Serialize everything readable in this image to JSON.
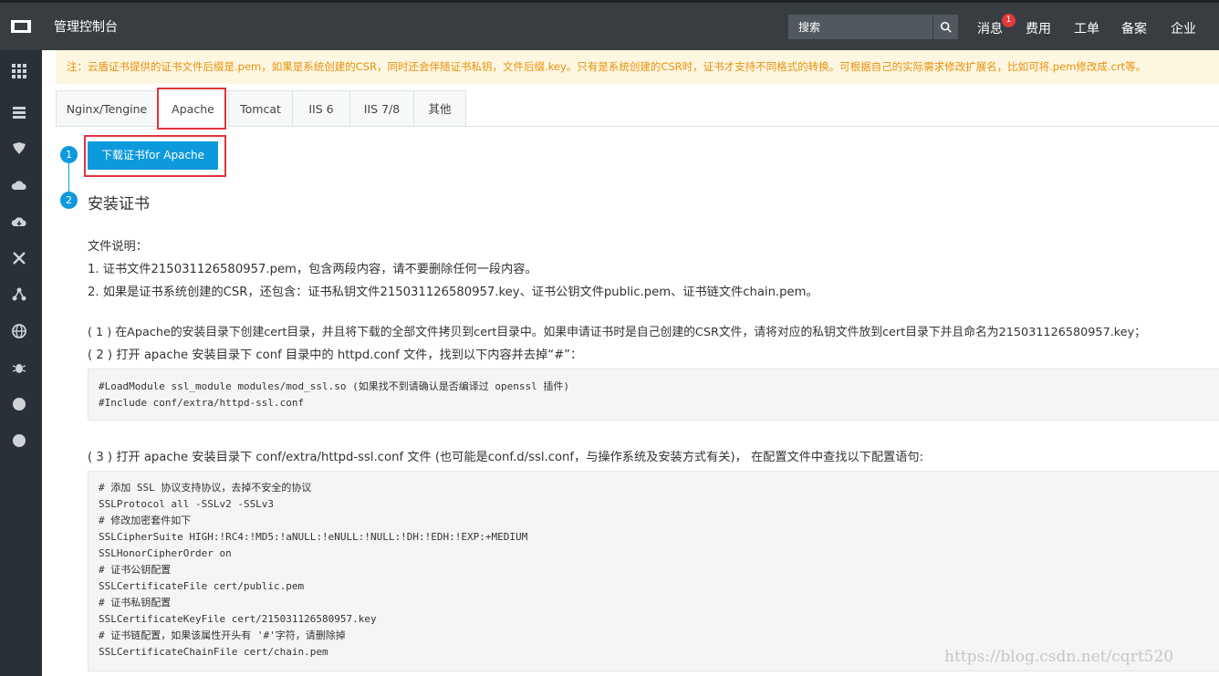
{
  "header": {
    "title": "管理控制台",
    "search_placeholder": "搜索",
    "nav": [
      "消息",
      "费用",
      "工单",
      "备案",
      "企业"
    ],
    "message_badge": "1"
  },
  "sidebar": {
    "icons": [
      "grid-icon",
      "list-icon",
      "shield-icon",
      "cloud-icon",
      "cloud-download-icon",
      "cross-icon",
      "nodes-icon",
      "globe-icon",
      "bug-icon",
      "circle-icon",
      "circle-icon"
    ]
  },
  "notice": "注：云盾证书提供的证书文件后缀是.pem，如果是系统创建的CSR，同时还会伴随证书私钥，文件后缀.key。只有是系统创建的CSR时，证书才支持不同格式的转换。可根据自己的实际需求修改扩展名，比如可将.pem修改成.crt等。",
  "tabs": [
    {
      "label": "Nginx/Tengine",
      "active": false
    },
    {
      "label": "Apache",
      "active": true
    },
    {
      "label": "Tomcat",
      "active": false
    },
    {
      "label": "IIS 6",
      "active": false
    },
    {
      "label": "IIS 7/8",
      "active": false
    },
    {
      "label": "其他",
      "active": false
    }
  ],
  "steps": {
    "step1_number": "1",
    "download_button": "下载证书for Apache",
    "step2_number": "2",
    "step2_title": "安装证书"
  },
  "content": {
    "file_desc_title": "文件说明：",
    "file_desc_1": "1. 证书文件215031126580957.pem，包含两段内容，请不要删除任何一段内容。",
    "file_desc_2": "2. 如果是证书系统创建的CSR，还包含：证书私钥文件215031126580957.key、证书公钥文件public.pem、证书链文件chain.pem。",
    "instruction_1": "( 1 ) 在Apache的安装目录下创建cert目录，并且将下载的全部文件拷贝到cert目录中。如果申请证书时是自己创建的CSR文件，请将对应的私钥文件放到cert目录下并且命名为215031126580957.key；",
    "instruction_2": "( 2 ) 打开 apache 安装目录下 conf 目录中的 httpd.conf 文件，找到以下内容并去掉“#”：",
    "code_1": [
      "#LoadModule ssl_module modules/mod_ssl.so (如果找不到请确认是否编译过 openssl 插件)",
      "#Include conf/extra/httpd-ssl.conf"
    ],
    "instruction_3": "( 3 ) 打开 apache 安装目录下 conf/extra/httpd-ssl.conf 文件 (也可能是conf.d/ssl.conf，与操作系统及安装方式有关)， 在配置文件中查找以下配置语句:",
    "code_2": [
      "# 添加 SSL 协议支持协议，去掉不安全的协议",
      "SSLProtocol all -SSLv2 -SSLv3",
      "# 修改加密套件如下",
      "SSLCipherSuite HIGH:!RC4:!MD5:!aNULL:!eNULL:!NULL:!DH:!EDH:!EXP:+MEDIUM",
      "SSLHonorCipherOrder on",
      "# 证书公钥配置",
      "SSLCertificateFile cert/public.pem",
      "# 证书私钥配置",
      "SSLCertificateKeyFile cert/215031126580957.key",
      "# 证书链配置，如果该属性开头有 '#'字符，请删除掉",
      "SSLCertificateChainFile cert/chain.pem"
    ]
  },
  "watermark": "https://blog.csdn.net/cqrt520",
  "colors": {
    "topbar": "#373d41",
    "sidebar": "#293038",
    "accent": "#0d9adc",
    "highlight": "#e0333b",
    "notice_text": "#e8900a",
    "notice_bg": "#fdf7e2"
  }
}
